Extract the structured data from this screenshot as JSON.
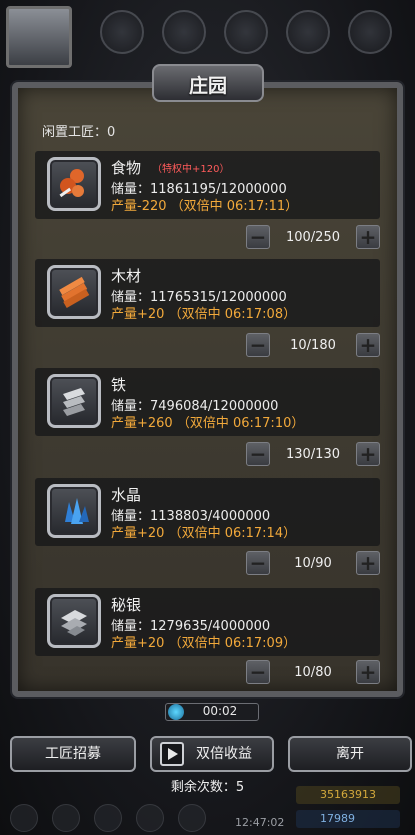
{
  "header": {
    "title": "庄园",
    "idle_artisans": "闲置工匠：0"
  },
  "resources": [
    {
      "name": "食物",
      "badge": "（特权中+120）",
      "stock": "储量：11861195/12000000",
      "production": "产量-220 （双倍中 06:17:11）",
      "workers": "100/250",
      "icon": "food-icon"
    },
    {
      "name": "木材",
      "stock": "储量：11765315/12000000",
      "production": "产量+20 （双倍中 06:17:08）",
      "workers": "10/180",
      "icon": "wood-icon"
    },
    {
      "name": "铁",
      "stock": "储量：7496084/12000000",
      "production": "产量+260 （双倍中 06:17:10）",
      "workers": "130/130",
      "icon": "iron-icon"
    },
    {
      "name": "水晶",
      "stock": "储量：1138803/4000000",
      "production": "产量+20 （双倍中 06:17:14）",
      "workers": "10/90",
      "icon": "crystal-icon"
    },
    {
      "name": "秘银",
      "stock": "储量：1279635/4000000",
      "production": "产量+20 （双倍中 06:17:09）",
      "workers": "10/80",
      "icon": "mithril-icon"
    }
  ],
  "stepper": {
    "minus": "−",
    "plus": "+"
  },
  "timer": {
    "value": "00:02"
  },
  "buttons": {
    "recruit": "工匠招募",
    "double": "双倍收益",
    "leave": "离开"
  },
  "remaining": "剩余次数：5",
  "hud": {
    "gold": "35163913",
    "gems": "17989",
    "time": "12:47:02"
  },
  "colors": {
    "production": "#f2a93b",
    "badge": "#ff5b5b",
    "panel": "#3f3b31"
  }
}
